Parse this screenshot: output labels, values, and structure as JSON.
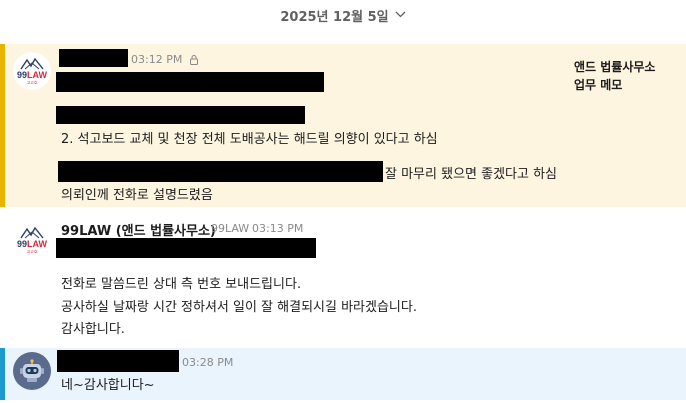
{
  "date_divider": {
    "label": "2025년 12월 5일",
    "icon": "chevron-down-icon"
  },
  "memo_message": {
    "time": "03:12 PM",
    "icon": "lock-icon",
    "note": [
      "앤드 법률사무소",
      "업무 메모"
    ],
    "line2": "2. 석고보드 교체 및 천장 전체 도배공사는 해드릴 의향이 있다고 하심",
    "line3_suffix": "잘 마무리 됐으면 좋겠다고 하심",
    "line4": "의뢰인께 전화로 설명드렸음"
  },
  "firm_message": {
    "sender": "99LAW (앤드 법률사무소)",
    "handle": "99LAW",
    "time": "03:13 PM",
    "lines": [
      "전화로 말씀드린 상대 측 번호 보내드립니다.",
      "공사하실 날짜랑 시간 정하셔서 일이 잘 해결되시길 바라겠습니다.",
      "감사합니다."
    ]
  },
  "reply_message": {
    "time": "03:28 PM",
    "text": "네~감사합니다~",
    "avatar_icon": "robot-icon"
  },
  "logo": {
    "text_left": "99",
    "text_right": "LAW",
    "sub": "고고호"
  },
  "colors": {
    "memo_bg": "#fdf5e0",
    "memo_bar": "#e8b400",
    "reply_bg": "#eaf4fc",
    "reply_bar": "#1d9bd1"
  }
}
